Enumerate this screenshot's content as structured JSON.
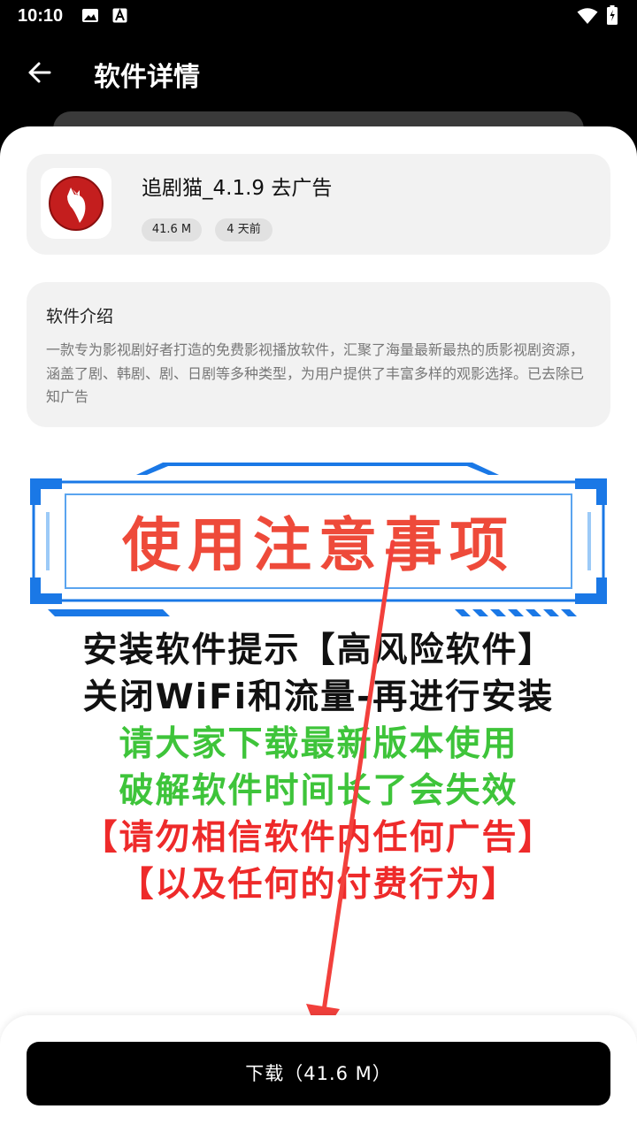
{
  "status_bar": {
    "time": "10:10",
    "icons": [
      "image-icon",
      "a-icon",
      "wifi-icon",
      "battery-icon"
    ]
  },
  "header": {
    "title": "软件详情",
    "back_icon": "arrow-left-icon"
  },
  "app": {
    "name": "追剧猫_4.1.9 去广告",
    "size": "41.6 M",
    "updated": "4 天前",
    "icon": "cat-logo-icon"
  },
  "description": {
    "title": "软件介绍",
    "text": "一款专为影视剧好者打造的免费影视播放软件，汇聚了海量最新最热的质影视剧资源，涵盖了剧、韩剧、剧、日剧等多种类型，为用户提供了丰富多样的观影选择。已去除已知广告"
  },
  "notice": {
    "title": "使用注意事项",
    "lines": [
      "安装软件提示【高风险软件】",
      "关闭WiFi和流量-再进行安装",
      "请大家下载最新版本使用",
      "破解软件时间长了会失效",
      "【请勿相信软件内任何广告】",
      "【以及任何的付费行为】"
    ]
  },
  "download": {
    "label": "下载（41.6 M）"
  },
  "colors": {
    "background": "#000000",
    "card": "#f2f2f2",
    "notice_red": "#ee4a3a",
    "notice_green": "#3ec43a",
    "frame_blue": "#1a78e6",
    "arrow_red": "#f2403c"
  }
}
